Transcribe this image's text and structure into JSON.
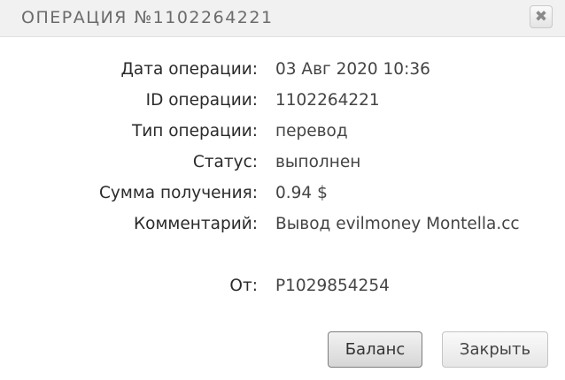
{
  "dialog": {
    "title": "ОПЕРАЦИЯ №1102264221",
    "close_icon": "close-icon",
    "close_glyph": "✖"
  },
  "details": {
    "date_label": "Дата операции:",
    "date_value": "03 Авг 2020 10:36",
    "id_label": "ID операции:",
    "id_value": "1102264221",
    "type_label": "Тип операции:",
    "type_value": "перевод",
    "status_label": "Статус:",
    "status_value": "выполнен",
    "amount_label": "Сумма получения:",
    "amount_value": "0.94 $",
    "comment_label": "Комментарий:",
    "comment_value": "Вывод evilmoney Montella.cc",
    "from_label": "От:",
    "from_value": "P1029854254"
  },
  "buttons": {
    "balance_label": "Баланс",
    "close_label": "Закрыть"
  }
}
